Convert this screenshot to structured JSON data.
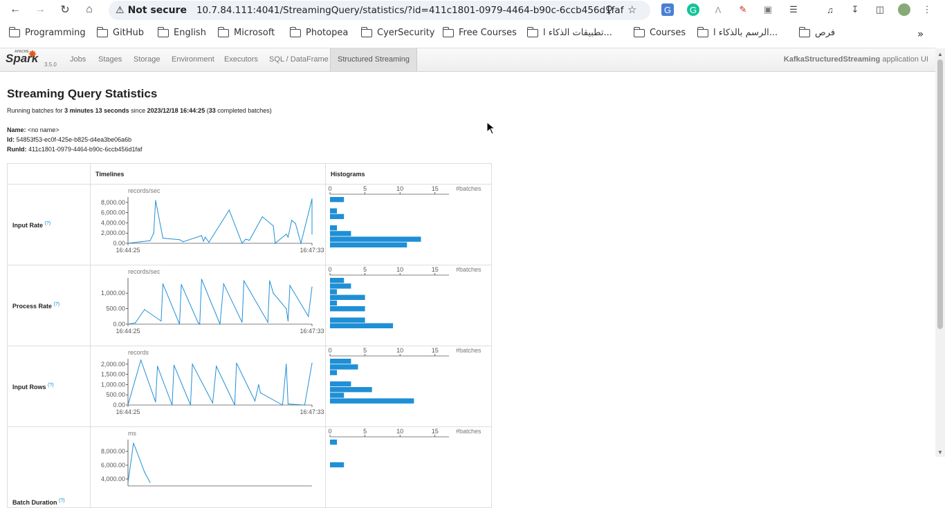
{
  "browser": {
    "security_label": "Not secure",
    "url": "10.7.84.111:4041/StreamingQuery/statistics/?id=411c1801-0979-4464-b90c-6ccb456d1faf",
    "bookmarks": [
      "Programming",
      "GitHub",
      "English",
      "Microsoft",
      "Photopea",
      "CyerSecurity",
      "Free Courses",
      "تطبيقات الذكاء ا...",
      "Courses",
      "الرسم بالذكاء ا...",
      "فرص"
    ]
  },
  "spark": {
    "logo": "Spark",
    "apache": "APACHE",
    "version": "3.5.0",
    "tabs": [
      "Jobs",
      "Stages",
      "Storage",
      "Environment",
      "Executors",
      "SQL / DataFrame",
      "Structured Streaming"
    ],
    "app_name": "KafkaStructuredStreaming",
    "app_suffix": " application UI"
  },
  "page": {
    "title": "Streaming Query Statistics",
    "running_prefix": "Running batches for ",
    "running_duration": "3 minutes 13 seconds",
    "running_since": " since ",
    "running_start": "2023/12/18 16:44:25",
    "running_open": " (",
    "completed_count": "33",
    "running_suffix": " completed batches)",
    "name_label": "Name:",
    "name_value": " <no name>",
    "id_label": "Id:",
    "id_value": " 54853f53-ec0f-425e-b825-d4ea3be06a6b",
    "runid_label": "RunId:",
    "runid_value": " 411c1801-0979-4464-b90c-6ccb456d1faf"
  },
  "table": {
    "col_timelines": "Timelines",
    "col_histograms": "Histograms",
    "help_mark": "(?)",
    "x_start": "16:44:25",
    "x_end": "16:47:33",
    "hist_unit": "#batches",
    "hist_ticks": [
      "0",
      "5",
      "10",
      "15"
    ]
  },
  "chart_data": [
    {
      "type": "line",
      "title": "Input Rate",
      "ylabel": "records/sec",
      "yticks": [
        "8,000.00",
        "6,000.00",
        "4,000.00",
        "2,000.00",
        "0.00"
      ],
      "ylim": [
        0,
        8800
      ],
      "x": [
        0,
        0.07,
        0.12,
        0.14,
        0.15,
        0.19,
        0.28,
        0.3,
        0.4,
        0.41,
        0.42,
        0.44,
        0.55,
        0.62,
        0.64,
        0.66,
        0.73,
        0.79,
        0.8,
        0.86,
        0.87,
        0.89,
        0.91,
        0.94,
        1.0,
        1.0
      ],
      "y": [
        0,
        300,
        500,
        2000,
        8400,
        1000,
        700,
        300,
        1500,
        400,
        1200,
        200,
        6500,
        0,
        800,
        600,
        5200,
        3400,
        0,
        1800,
        1200,
        4500,
        3900,
        0,
        8700,
        1800
      ]
    },
    {
      "type": "bar",
      "title": "Input Rate histogram",
      "xlabel": "#batches",
      "xlim": [
        0,
        17
      ],
      "values": [
        2,
        0,
        1,
        2,
        0,
        1,
        3,
        13,
        11
      ]
    },
    {
      "type": "line",
      "title": "Process Rate",
      "ylabel": "records/sec",
      "yticks": [
        "1,000.00",
        "500.00",
        "0.00"
      ],
      "ylim": [
        0,
        1450
      ],
      "x": [
        0,
        0.04,
        0.09,
        0.18,
        0.19,
        0.28,
        0.29,
        0.38,
        0.39,
        0.4,
        0.5,
        0.52,
        0.62,
        0.63,
        0.76,
        0.77,
        0.79,
        0.86,
        0.87,
        0.88,
        0.98,
        1.0
      ],
      "y": [
        0,
        40,
        470,
        100,
        1300,
        0,
        1280,
        60,
        0,
        1450,
        0,
        1300,
        60,
        1400,
        60,
        1400,
        1000,
        500,
        100,
        1250,
        250,
        1200
      ]
    },
    {
      "type": "bar",
      "title": "Process Rate histogram",
      "xlabel": "#batches",
      "xlim": [
        0,
        17
      ],
      "values": [
        2,
        3,
        1,
        5,
        1,
        5,
        0,
        5,
        9
      ]
    },
    {
      "type": "line",
      "title": "Input Rows",
      "ylabel": "records",
      "yticks": [
        "2,000.00",
        "1,500.00",
        "1,000.00",
        "500.00",
        "0.00"
      ],
      "ylim": [
        0,
        2200
      ],
      "x": [
        0,
        0.07,
        0.15,
        0.16,
        0.24,
        0.25,
        0.34,
        0.35,
        0.46,
        0.48,
        0.58,
        0.59,
        0.69,
        0.71,
        0.72,
        0.84,
        0.86,
        0.87,
        0.96,
        1.0
      ],
      "y": [
        0,
        2200,
        150,
        1900,
        0,
        1950,
        0,
        2000,
        100,
        1900,
        0,
        2050,
        200,
        1000,
        600,
        0,
        2000,
        50,
        0,
        2050
      ]
    },
    {
      "type": "bar",
      "title": "Input Rows histogram",
      "xlabel": "#batches",
      "xlim": [
        0,
        17
      ],
      "values": [
        3,
        4,
        1,
        0,
        3,
        6,
        2,
        12
      ]
    },
    {
      "type": "line",
      "title": "Batch Duration",
      "ylabel": "ms",
      "yticks": [
        "8,000.00",
        "6,000.00",
        "4,000.00"
      ],
      "ylim": [
        3000,
        9500
      ],
      "x": [
        0,
        0.03,
        0.09,
        0.12
      ],
      "y": [
        3500,
        9200,
        5000,
        3500
      ]
    },
    {
      "type": "bar",
      "title": "Batch Duration histogram",
      "xlabel": "#batches",
      "xlim": [
        0,
        17
      ],
      "values": [
        1,
        0,
        0,
        0,
        2
      ]
    }
  ]
}
